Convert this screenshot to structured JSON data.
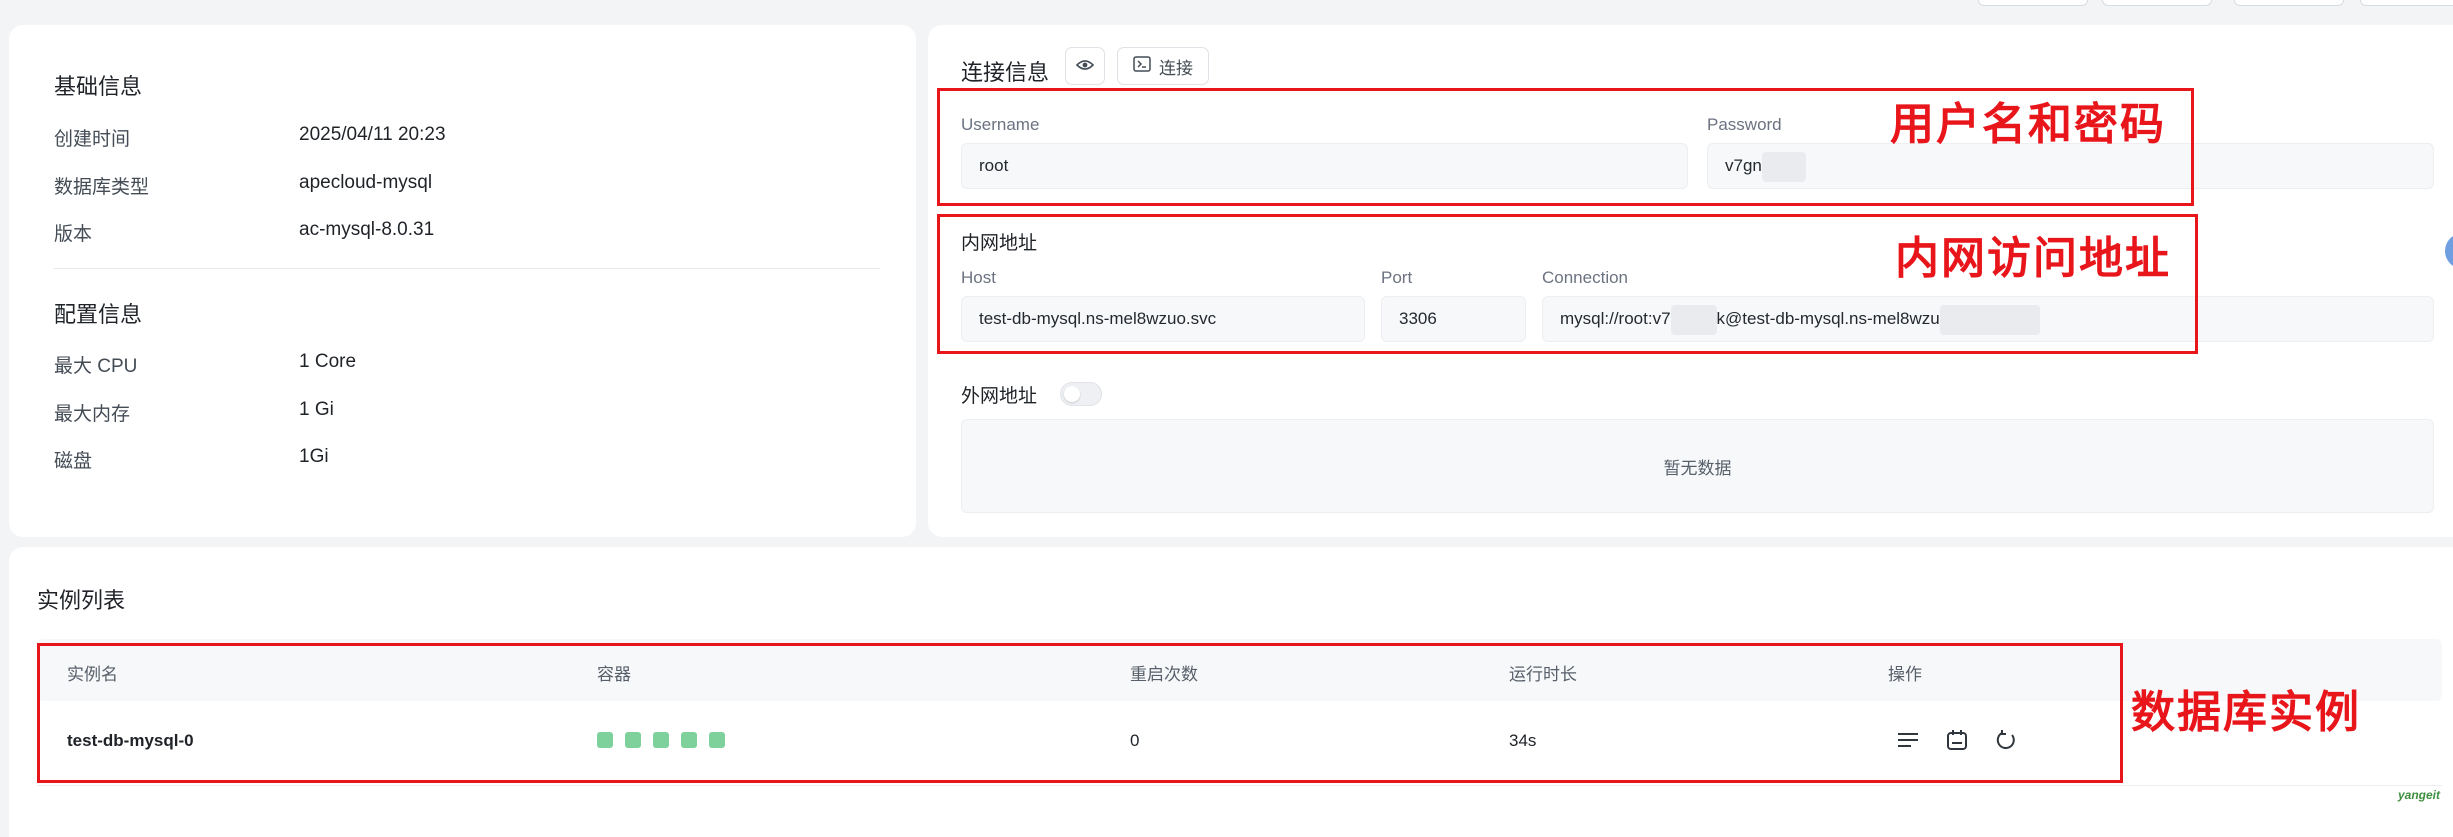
{
  "basic_info": {
    "title": "基础信息",
    "rows": [
      {
        "label": "创建时间",
        "value": "2025/04/11 20:23"
      },
      {
        "label": "数据库类型",
        "value": "apecloud-mysql"
      },
      {
        "label": "版本",
        "value": "ac-mysql-8.0.31"
      }
    ]
  },
  "config_info": {
    "title": "配置信息",
    "rows": [
      {
        "label": "最大 CPU",
        "value": "1 Core"
      },
      {
        "label": "最大内存",
        "value": "1 Gi"
      },
      {
        "label": "磁盘",
        "value": "1Gi"
      }
    ]
  },
  "connection": {
    "title": "连接信息",
    "eye_icon": "eye-icon",
    "connect_button_label": "连接",
    "terminal_icon": "terminal-icon",
    "username_label": "Username",
    "username_value": "root",
    "password_label": "Password",
    "password_value": "v7gn",
    "internal_title": "内网地址",
    "host_label": "Host",
    "host_value": "test-db-mysql.ns-mel8wzuo.svc",
    "port_label": "Port",
    "port_value": "3306",
    "connection_label": "Connection",
    "connection_value_a": "mysql://root:v7",
    "connection_value_b": "k@test-db-mysql.ns-mel8wzu",
    "external_title": "外网地址",
    "external_enabled": false,
    "empty_text": "暂无数据"
  },
  "instances": {
    "title": "实例列表",
    "columns": [
      "实例名",
      "容器",
      "重启次数",
      "运行时长",
      "操作"
    ],
    "rows": [
      {
        "name": "test-db-mysql-0",
        "containers": 5,
        "container_color": "#7fd19c",
        "restarts": "0",
        "uptime": "34s",
        "actions": [
          "detail-list-icon",
          "calendar-icon",
          "restart-icon"
        ]
      }
    ]
  },
  "annotations": {
    "credentials": "用户名和密码",
    "internal": "内网访问地址",
    "instance": "数据库实例"
  },
  "colors": {
    "annotation_red": "#e8151b",
    "container_green": "#7fd19c"
  },
  "watermark": "yangeit"
}
